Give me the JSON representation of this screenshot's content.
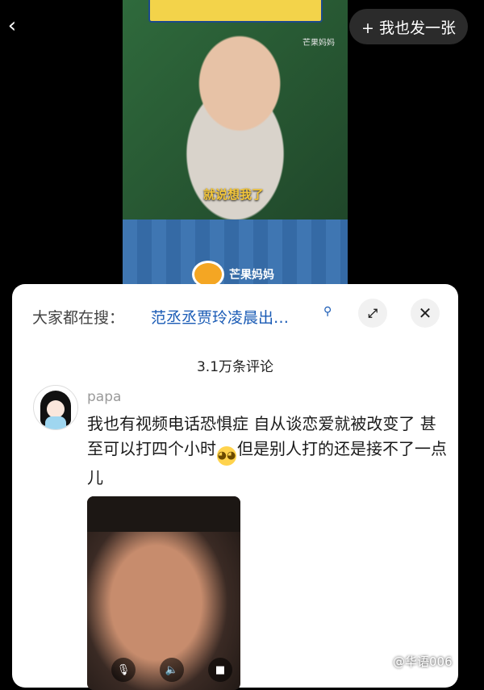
{
  "video": {
    "watermark_top": "芒果妈妈",
    "subtitle": "就说想我了",
    "brand_name": "芒果妈妈"
  },
  "header": {
    "back_icon": "chevron-left-icon",
    "post_button_label": "+ 我也发一张"
  },
  "sheet": {
    "search_label": "大家都在搜：",
    "search_query": "范丞丞贾玲凌晨出…",
    "search_icon": "search-icon",
    "expand_icon": "expand-icon",
    "close_icon": "close-icon",
    "comment_count": "3.1万条评论"
  },
  "comment": {
    "username": "papa",
    "text_before_emoji": "我也有视频电话恐惧症 自从谈恋爱就被改变了 甚至可以打四个小时",
    "text_after_emoji": "但是别人打的还是接不了一点儿",
    "emoji_icon": "pleading-face-icon",
    "call_controls": [
      "mic-icon",
      "speaker-icon",
      "camera-icon"
    ]
  },
  "watermark": "@华语006",
  "colors": {
    "link": "#1a5bb5",
    "sheet_bg": "#ffffff",
    "page_bg": "#000000"
  }
}
